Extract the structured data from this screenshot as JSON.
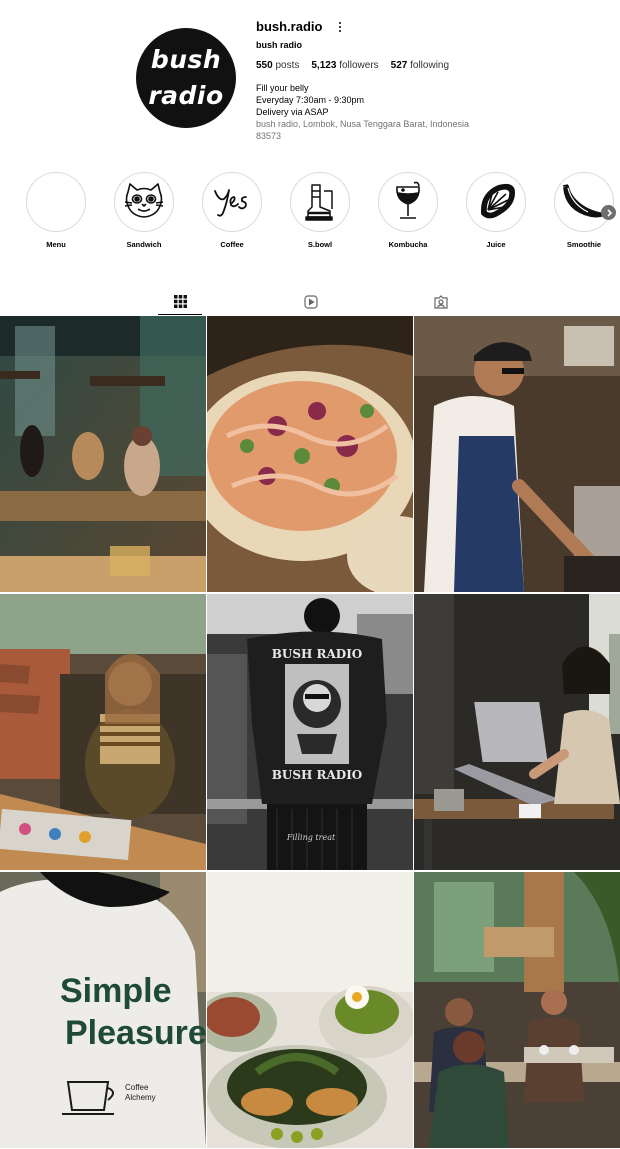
{
  "profile": {
    "avatar_line1": "bush",
    "avatar_line2": "radio",
    "username": "bush.radio",
    "full_name": "bush radio",
    "posts_count": "550",
    "posts_label": "posts",
    "followers_count": "5,123",
    "followers_label": "followers",
    "following_count": "527",
    "following_label": "following",
    "bio_lines": [
      "Fill your belly",
      "Everyday 7:30am - 9:30pm",
      "Delivery via ASAP"
    ],
    "address_lines": [
      "bush radio, Lombok, Nusa Tenggara Barat, Indonesia",
      "83573"
    ]
  },
  "highlights": [
    {
      "label": "Menu",
      "icon": "blank"
    },
    {
      "label": "Sandwich",
      "icon": "cat-face-icon"
    },
    {
      "label": "Coffee",
      "icon": "yes-script-icon"
    },
    {
      "label": "S.bowl",
      "icon": "boots-icon"
    },
    {
      "label": "Kombucha",
      "icon": "wine-glass-icon"
    },
    {
      "label": "Juice",
      "icon": "citrus-slice-icon"
    },
    {
      "label": "Smoothie",
      "icon": "banana-icon"
    }
  ],
  "tabs": [
    {
      "name": "posts",
      "icon": "grid-icon",
      "active": true
    },
    {
      "name": "reels",
      "icon": "reels-icon",
      "active": false
    },
    {
      "name": "tagged",
      "icon": "tagged-icon",
      "active": false
    }
  ],
  "posts": [
    {
      "subject": "cafe interior with guests",
      "tshirt_text": ""
    },
    {
      "subject": "flatbread taco with sauce",
      "tshirt_text": ""
    },
    {
      "subject": "barista at espresso machine",
      "tshirt_text": ""
    },
    {
      "subject": "woman eating on sofa",
      "tshirt_text": ""
    },
    {
      "subject": "back of black t-shirt",
      "tshirt_text": [
        "BUSH RADIO",
        "BUSH RADIO",
        "Filling treat"
      ]
    },
    {
      "subject": "woman working on laptop",
      "tshirt_text": ""
    },
    {
      "subject": "back of white t-shirt",
      "tshirt_text": [
        "Simple",
        "Pleasure",
        "Coffee",
        "Alchemy"
      ]
    },
    {
      "subject": "plates of food",
      "tshirt_text": ""
    },
    {
      "subject": "busy cafe interior",
      "tshirt_text": ""
    }
  ],
  "colors": {
    "avatar_bg": "#111111",
    "muted_text": "#737373",
    "ring": "#dbdbdb",
    "next_button": "#6e6e6e"
  }
}
